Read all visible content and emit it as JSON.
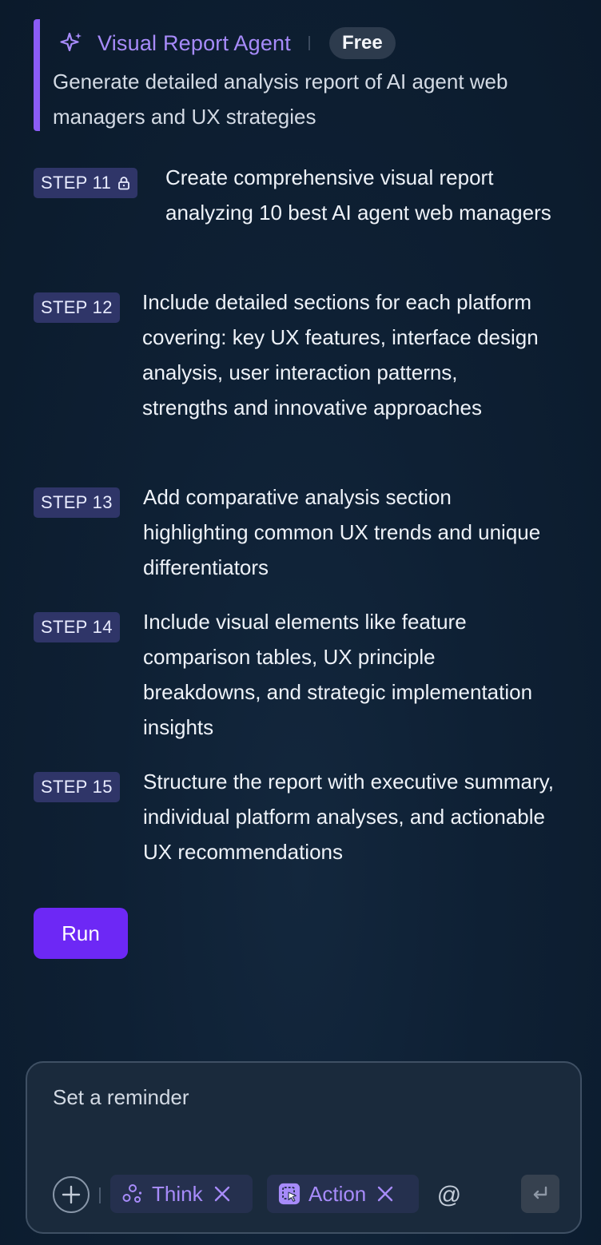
{
  "header": {
    "agent_name": "Visual Report Agent",
    "badge": "Free",
    "description": "Generate detailed analysis report of AI agent web managers and UX strategies",
    "icon": "sparkle-icon"
  },
  "steps": [
    {
      "label": "STEP 11",
      "locked": true,
      "text": "Create comprehensive visual report analyzing 10 best AI agent web managers"
    },
    {
      "label": "STEP 12",
      "locked": false,
      "text": "Include detailed sections for each platform covering: key UX features, interface design analysis, user interaction patterns, strengths and innovative approaches"
    },
    {
      "label": "STEP 13",
      "locked": false,
      "text": "Add comparative analysis section highlighting common UX trends and unique differentiators"
    },
    {
      "label": "STEP 14",
      "locked": false,
      "text": "Include visual elements like feature comparison tables, UX principle breakdowns, and strategic implementation insights"
    },
    {
      "label": "STEP 15",
      "locked": false,
      "text": "Structure the report with executive summary, individual platform analyses, and actionable UX recommendations"
    }
  ],
  "run_button": {
    "label": "Run"
  },
  "composer": {
    "placeholder": "Set a reminder",
    "chips": [
      {
        "label": "Think",
        "icon": "think-icon"
      },
      {
        "label": "Action",
        "icon": "action-icon"
      }
    ],
    "mention_symbol": "@"
  },
  "colors": {
    "accent": "#8b5cf6",
    "run_button": "#6d28f5",
    "step_badge": "#2f3568",
    "background": "#0e2034"
  }
}
